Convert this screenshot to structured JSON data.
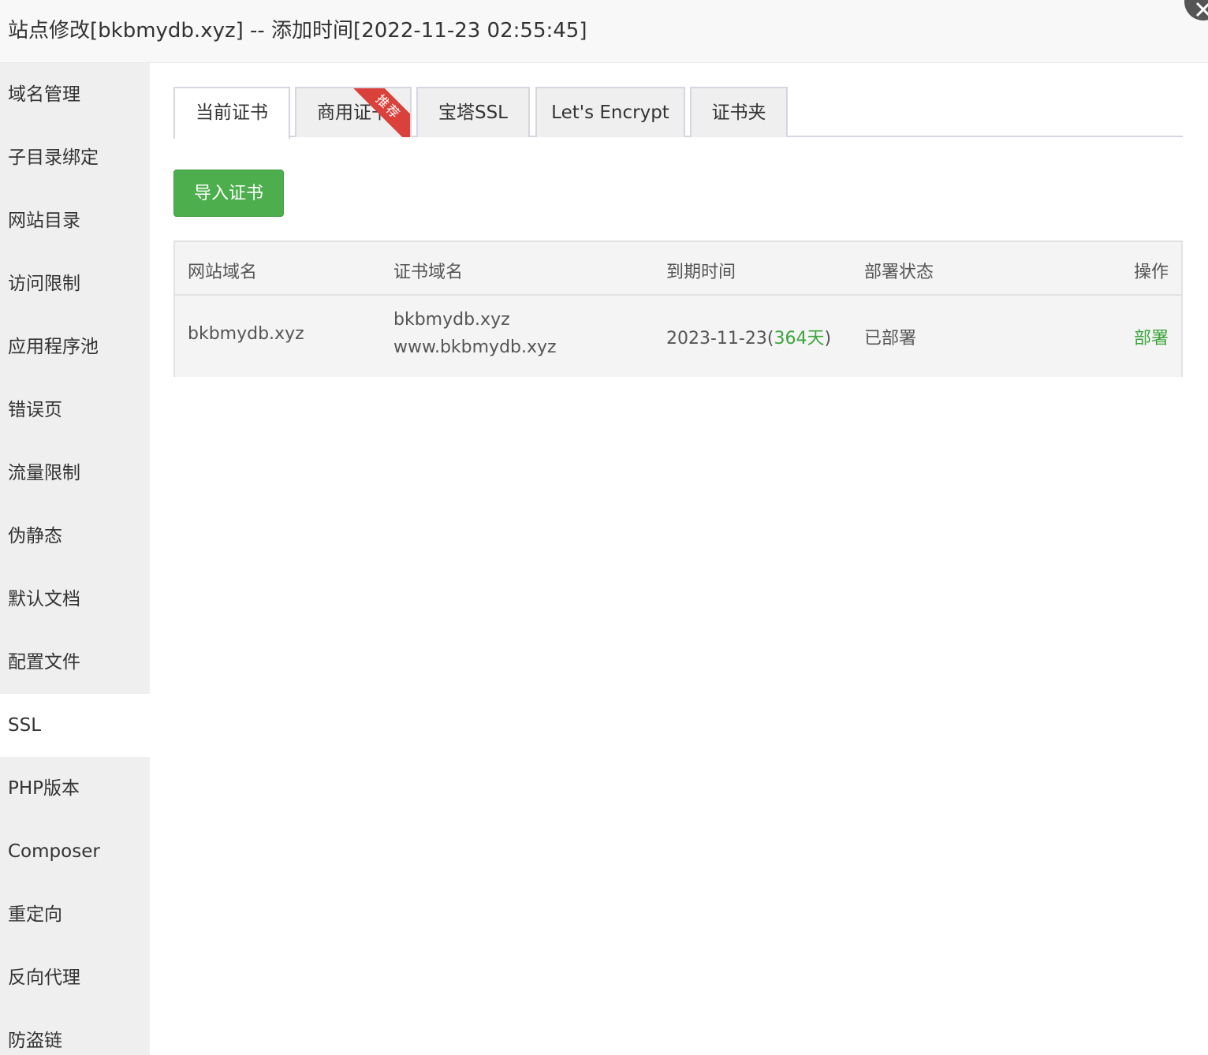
{
  "window": {
    "title": "站点修改[bkbmydb.xyz] -- 添加时间[2022-11-23 02:55:45]"
  },
  "sidebar": {
    "items": [
      {
        "label": "域名管理"
      },
      {
        "label": "子目录绑定"
      },
      {
        "label": "网站目录"
      },
      {
        "label": "访问限制"
      },
      {
        "label": "应用程序池"
      },
      {
        "label": "错误页"
      },
      {
        "label": "流量限制"
      },
      {
        "label": "伪静态"
      },
      {
        "label": "默认文档"
      },
      {
        "label": "配置文件"
      },
      {
        "label": "SSL"
      },
      {
        "label": "PHP版本"
      },
      {
        "label": "Composer"
      },
      {
        "label": "重定向"
      },
      {
        "label": "反向代理"
      },
      {
        "label": "防盗链"
      }
    ],
    "active": "SSL"
  },
  "tabs": {
    "items": [
      {
        "label": "当前证书"
      },
      {
        "label": "商用证书",
        "badge": "推荐"
      },
      {
        "label": "宝塔SSL"
      },
      {
        "label": "Let's Encrypt"
      },
      {
        "label": "证书夹"
      }
    ],
    "active": "当前证书"
  },
  "actions": {
    "import_label": "导入证书"
  },
  "table": {
    "headers": [
      "网站域名",
      "证书域名",
      "到期时间",
      "部署状态",
      "操作"
    ],
    "rows": [
      {
        "site_domain": "bkbmydb.xyz",
        "cert_domains": [
          "bkbmydb.xyz",
          "www.bkbmydb.xyz"
        ],
        "expire_date": "2023-11-23",
        "days_open": "(",
        "days_left": "364天",
        "days_close": ")",
        "status": "已部署",
        "operation": "部署"
      }
    ]
  },
  "colors": {
    "accent_green": "#4cae4c",
    "badge_red": "#d9413a"
  }
}
